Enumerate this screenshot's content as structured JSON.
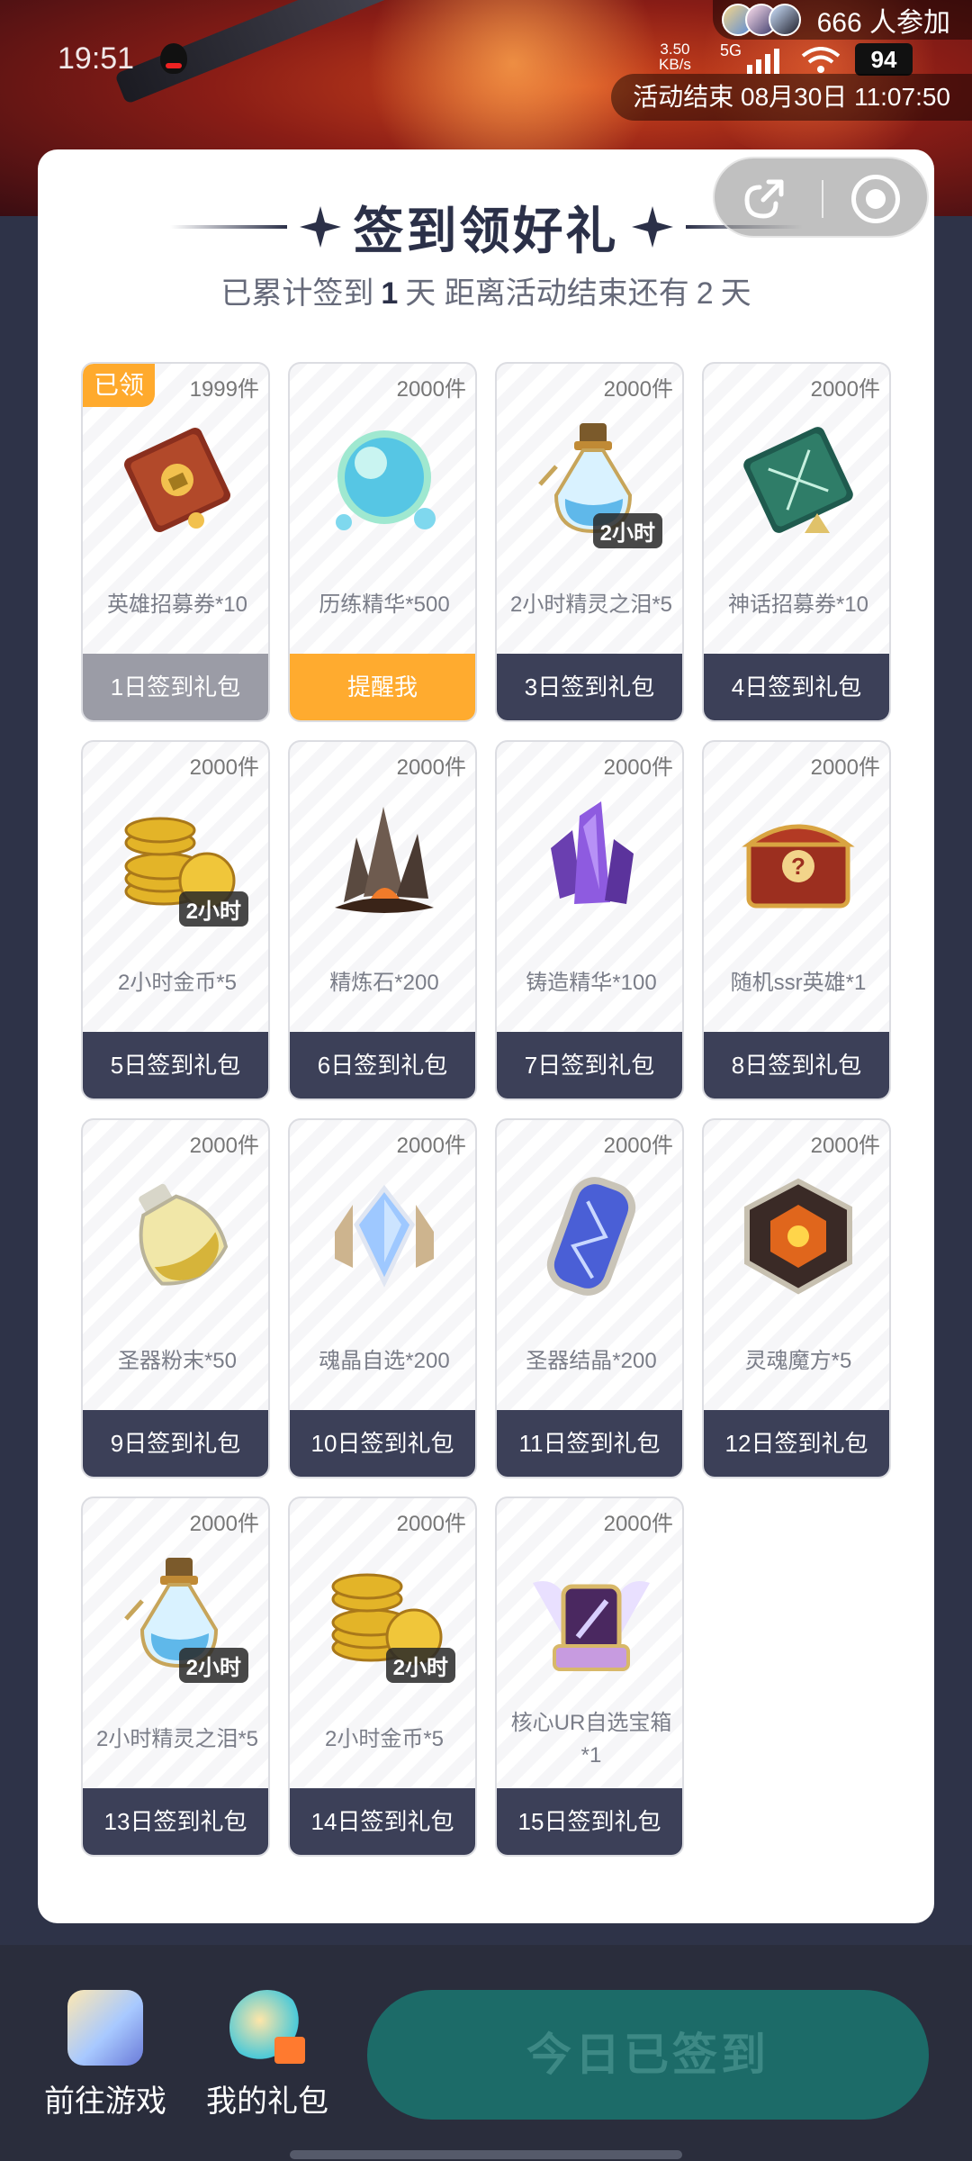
{
  "status_bar": {
    "time": "19:51",
    "net_speed_top": "3.50",
    "net_speed_bottom": "KB/s",
    "network": "5G",
    "battery": "94"
  },
  "banner": {
    "participants": "666 人参加",
    "countdown": "活动结束 08月30日 11:07:50"
  },
  "card": {
    "title": "签到领好礼",
    "subtitle_prefix": "已累计签到",
    "signed_days": "1",
    "subtitle_mid": "天  距离活动结束还有",
    "remaining_days": "2",
    "subtitle_suffix": "天"
  },
  "gifts": [
    {
      "stock": "1999件",
      "name": "英雄招募券*10",
      "button": "1日签到礼包",
      "state": "claimed",
      "claimed_label": "已领",
      "icon": "red-book-icon"
    },
    {
      "stock": "2000件",
      "name": "历练精华*500",
      "button": "提醒我",
      "state": "remind",
      "icon": "essence-orb-icon"
    },
    {
      "stock": "2000件",
      "name": "2小时精灵之泪*5",
      "button": "3日签到礼包",
      "state": "locked",
      "tag": "2小时",
      "icon": "potion-bottle-icon"
    },
    {
      "stock": "2000件",
      "name": "神话招募券*10",
      "button": "4日签到礼包",
      "state": "locked",
      "icon": "green-book-icon"
    },
    {
      "stock": "2000件",
      "name": "2小时金币*5",
      "button": "5日签到礼包",
      "state": "locked",
      "tag": "2小时",
      "icon": "gold-coins-icon"
    },
    {
      "stock": "2000件",
      "name": "精炼石*200",
      "button": "6日签到礼包",
      "state": "locked",
      "icon": "refine-stone-icon"
    },
    {
      "stock": "2000件",
      "name": "铸造精华*100",
      "button": "7日签到礼包",
      "state": "locked",
      "icon": "purple-crystal-icon"
    },
    {
      "stock": "2000件",
      "name": "随机ssr英雄*1",
      "button": "8日签到礼包",
      "state": "locked",
      "icon": "mystery-chest-icon"
    },
    {
      "stock": "2000件",
      "name": "圣器粉末*50",
      "button": "9日签到礼包",
      "state": "locked",
      "icon": "powder-jar-icon"
    },
    {
      "stock": "2000件",
      "name": "魂晶自选*200",
      "button": "10日签到礼包",
      "state": "locked",
      "icon": "soul-crystal-icon"
    },
    {
      "stock": "2000件",
      "name": "圣器结晶*200",
      "button": "11日签到礼包",
      "state": "locked",
      "icon": "relic-crystal-icon"
    },
    {
      "stock": "2000件",
      "name": "灵魂魔方*5",
      "button": "12日签到礼包",
      "state": "locked",
      "icon": "soul-cube-icon"
    },
    {
      "stock": "2000件",
      "name": "2小时精灵之泪*5",
      "button": "13日签到礼包",
      "state": "locked",
      "tag": "2小时",
      "icon": "potion-bottle-icon"
    },
    {
      "stock": "2000件",
      "name": "2小时金币*5",
      "button": "14日签到礼包",
      "state": "locked",
      "tag": "2小时",
      "icon": "gold-coins-icon"
    },
    {
      "stock": "2000件",
      "name": "核心UR自选宝箱*1",
      "button": "15日签到礼包",
      "state": "locked",
      "icon": "winged-shield-chest-icon"
    }
  ],
  "bottom_bar": {
    "go_game": "前往游戏",
    "my_gifts": "我的礼包",
    "checkin_button": "今日已签到"
  }
}
